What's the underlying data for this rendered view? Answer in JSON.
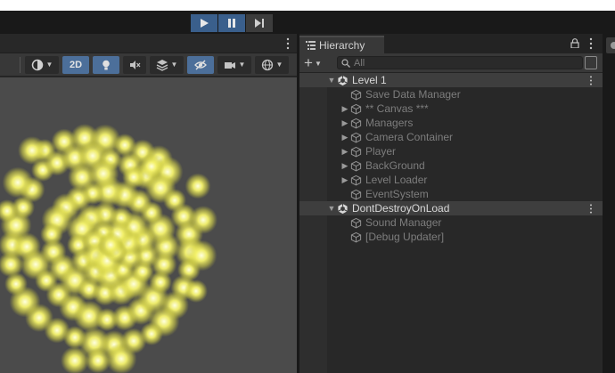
{
  "toolbar": {
    "play_icon": "play-icon",
    "pause_icon": "pause-icon",
    "step_icon": "step-icon",
    "accent": "#3a5f8c"
  },
  "scene_view": {
    "mode_2d_label": "2D",
    "viewport_bg": "#4b4b4b",
    "particle_color": "#f2f06a",
    "icons": [
      "shading-mode-icon",
      "2d-toggle",
      "lighting-icon",
      "audio-mute-icon",
      "effects-icon",
      "visibility-hidden-icon",
      "camera-icon",
      "gizmos-icon"
    ]
  },
  "hierarchy": {
    "tab_label": "Hierarchy",
    "search_placeholder": "All",
    "scenes": [
      {
        "name": "Level 1",
        "children": [
          {
            "name": "Save Data Manager",
            "has_children": false
          },
          {
            "name": "** Canvas ***",
            "has_children": true
          },
          {
            "name": "Managers",
            "has_children": true
          },
          {
            "name": "Camera Container",
            "has_children": true
          },
          {
            "name": "Player",
            "has_children": true
          },
          {
            "name": "BackGround",
            "has_children": true
          },
          {
            "name": "Level Loader",
            "has_children": true
          },
          {
            "name": "EventSystem",
            "has_children": false
          }
        ]
      },
      {
        "name": "DontDestroyOnLoad",
        "children": [
          {
            "name": "Sound Manager",
            "has_children": false
          },
          {
            "name": "[Debug Updater]",
            "has_children": false
          }
        ]
      }
    ]
  }
}
